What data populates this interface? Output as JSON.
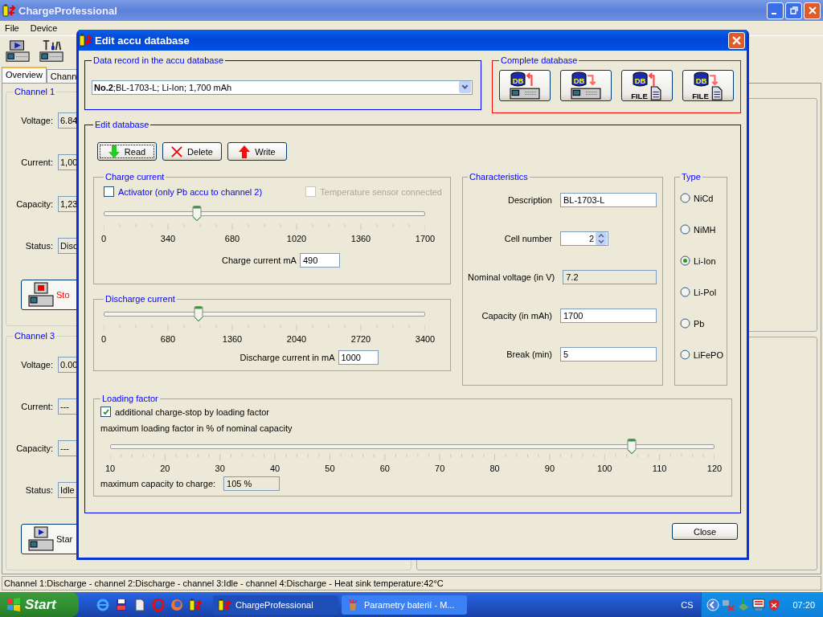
{
  "main_window": {
    "title": "ChargeProfessional",
    "menu": [
      "File",
      "Device"
    ],
    "tabs": [
      {
        "label": "Overview",
        "selected": true
      },
      {
        "label": "Chann",
        "selected": false
      }
    ],
    "channels": [
      {
        "title": "Channel 1",
        "fields": [
          {
            "label": "Voltage:",
            "value": "6.84"
          },
          {
            "label": "Current:",
            "value": "1,00"
          },
          {
            "label": "Capacity:",
            "value": "1,23"
          },
          {
            "label": "Status:",
            "value": "Disc"
          }
        ],
        "button": {
          "label": "Sto",
          "kind": "stop"
        }
      },
      {
        "title": "Channel 3",
        "fields": [
          {
            "label": "Voltage:",
            "value": "0.00"
          },
          {
            "label": "Current:",
            "value": "---"
          },
          {
            "label": "Capacity:",
            "value": "---"
          },
          {
            "label": "Status:",
            "value": "Idle"
          }
        ],
        "button": {
          "label": "Star",
          "kind": "start"
        }
      }
    ],
    "status_bar": "Channel 1:Discharge - channel 2:Discharge - channel 3:Idle - channel 4:Discharge - Heat sink temperature:42°C"
  },
  "dialog": {
    "title": "Edit accu database",
    "record": {
      "title": "Data record in the accu database",
      "value": "**No.2**;BL-1703-L; Li-Ion; 1,700 mAh"
    },
    "complete": {
      "title": "Complete database",
      "buttons": [
        {
          "kind": "device-up",
          "badge": "DB"
        },
        {
          "kind": "device-down",
          "badge": "DB"
        },
        {
          "kind": "file-up",
          "badge": "DB",
          "label": "FILE"
        },
        {
          "kind": "file-down",
          "badge": "DB",
          "label": "FILE"
        }
      ]
    },
    "edit": {
      "title": "Edit database",
      "actions": [
        {
          "label": "Read",
          "kind": "read",
          "focused": true
        },
        {
          "label": "Delete",
          "kind": "delete",
          "focused": false
        },
        {
          "label": "Write",
          "kind": "write",
          "focused": false
        }
      ],
      "charge": {
        "title": "Charge current",
        "options": [
          {
            "label": "Activator (only Pb accu to channel 2)",
            "checked": false,
            "disabled": false
          },
          {
            "label": "Temperature sensor connected",
            "checked": false,
            "disabled": true
          }
        ],
        "slider": {
          "level": 0.288,
          "ticks": [
            "0",
            "340",
            "680",
            "1020",
            "1360",
            "1700"
          ]
        },
        "field": {
          "label": "Charge current mA",
          "value": "490"
        }
      },
      "discharge": {
        "title": "Discharge current",
        "slider": {
          "level": 0.294,
          "ticks": [
            "0",
            "680",
            "1360",
            "2040",
            "2720",
            "3400"
          ]
        },
        "field": {
          "label": "Discharge current in mA",
          "value": "1000"
        }
      },
      "characteristics": {
        "title": "Characteristics",
        "fields": [
          {
            "label": "Description",
            "value": "BL-1703-L",
            "kind": "text"
          },
          {
            "label": "Cell number",
            "value": "2",
            "kind": "spinner"
          },
          {
            "label": "Nominal voltage (in V)",
            "value": "7.2",
            "kind": "readonly"
          },
          {
            "label": "Capacity (in mAh)",
            "value": "1700",
            "kind": "text"
          },
          {
            "label": "Break (min)",
            "value": "5",
            "kind": "text"
          }
        ]
      },
      "type": {
        "title": "Type",
        "options": [
          {
            "label": "NiCd",
            "selected": false
          },
          {
            "label": "NiMH",
            "selected": false
          },
          {
            "label": "Li-Ion",
            "selected": true
          },
          {
            "label": "Li-Pol",
            "selected": false
          },
          {
            "label": "Pb",
            "selected": false
          },
          {
            "label": "LiFePO",
            "selected": false
          }
        ]
      },
      "loading": {
        "title": "Loading factor",
        "option": {
          "label": "additional charge-stop by loading factor",
          "checked": true
        },
        "slider_label": "maximum loading factor in % of nominal capacity",
        "slider": {
          "level": 0.864,
          "ticks": [
            "10",
            "20",
            "30",
            "40",
            "50",
            "60",
            "70",
            "80",
            "90",
            "100",
            "110",
            "120"
          ]
        },
        "result": {
          "label": "maximum capacity to charge:",
          "value": "105 %"
        }
      }
    },
    "close": "Close"
  },
  "taskbar": {
    "start": "Start",
    "tasks": [
      {
        "label": "ChargeProfessional",
        "selected": true
      },
      {
        "label": "Parametry baterií - M...",
        "selected": false
      }
    ],
    "language": "CS",
    "clock": "07:20"
  }
}
